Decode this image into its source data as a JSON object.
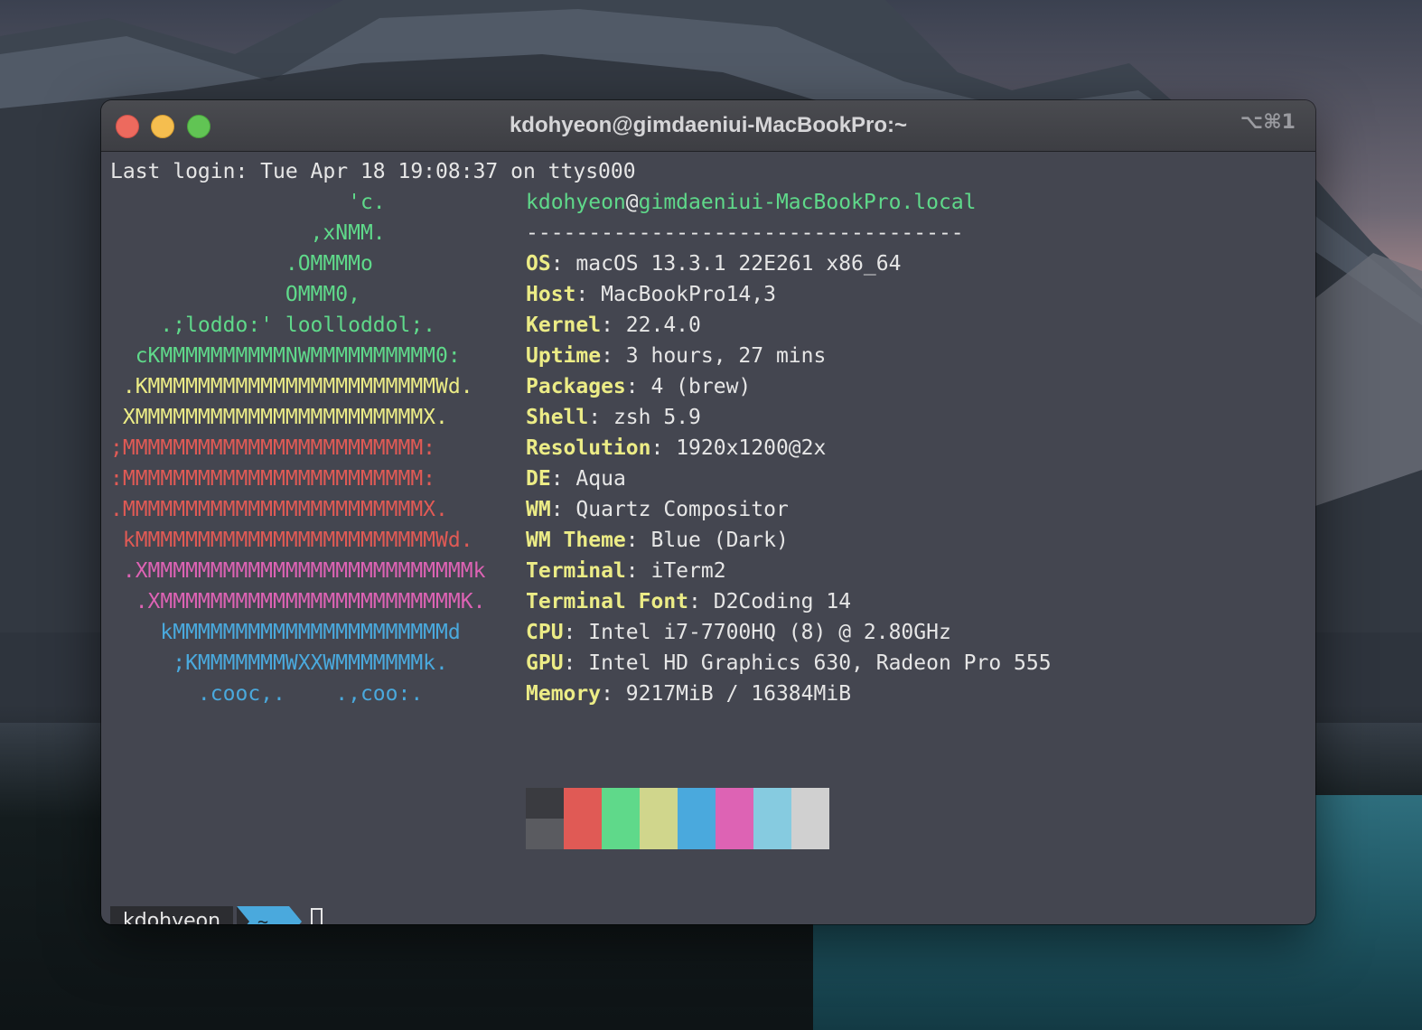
{
  "window": {
    "title": "kdohyeon@gimdaeniui-MacBookPro:~",
    "shortcut": "⌥⌘1"
  },
  "terminal": {
    "last_login": "Last login: Tue Apr 18 19:08:37 on ttys000",
    "ascii_art": [
      {
        "text": "                   'c.",
        "color": "#5fd98a"
      },
      {
        "text": "                ,xNMM.",
        "color": "#5fd98a"
      },
      {
        "text": "              .OMMMMo",
        "color": "#5fd98a"
      },
      {
        "text": "              OMMM0,",
        "color": "#5fd98a"
      },
      {
        "text": "    .;loddo:' loolloddol;.",
        "color": "#5fd98a"
      },
      {
        "text": "  cKMMMMMMMMMMNWMMMMMMMMMM0:",
        "color": "#5fd98a"
      },
      {
        "text": " .KMMMMMMMMMMMMMMMMMMMMMMMWd.",
        "color": "#ecec86"
      },
      {
        "text": " XMMMMMMMMMMMMMMMMMMMMMMMX.",
        "color": "#ecec86"
      },
      {
        "text": ";MMMMMMMMMMMMMMMMMMMMMMMM:",
        "color": "#e05a55"
      },
      {
        "text": ":MMMMMMMMMMMMMMMMMMMMMMMM:",
        "color": "#e05a55"
      },
      {
        "text": ".MMMMMMMMMMMMMMMMMMMMMMMMX.",
        "color": "#e05a55"
      },
      {
        "text": " kMMMMMMMMMMMMMMMMMMMMMMMMWd.",
        "color": "#e05a55"
      },
      {
        "text": " .XMMMMMMMMMMMMMMMMMMMMMMMMMMk",
        "color": "#dd63b4"
      },
      {
        "text": "  .XMMMMMMMMMMMMMMMMMMMMMMMMK.",
        "color": "#dd63b4"
      },
      {
        "text": "    kMMMMMMMMMMMMMMMMMMMMMMd",
        "color": "#4aa9dd"
      },
      {
        "text": "     ;KMMMMMMMWXXWMMMMMMMk.",
        "color": "#4aa9dd"
      },
      {
        "text": "       .cooc,.    .,coo:.",
        "color": "#4aa9dd"
      }
    ],
    "host_user": "kdohyeon",
    "host_at": "@",
    "host_name": "gimdaeniui-MacBookPro.local",
    "separator": "-----------------------------------",
    "info": [
      {
        "key": "OS",
        "value": "macOS 13.3.1 22E261 x86_64"
      },
      {
        "key": "Host",
        "value": "MacBookPro14,3"
      },
      {
        "key": "Kernel",
        "value": "22.4.0"
      },
      {
        "key": "Uptime",
        "value": "3 hours, 27 mins"
      },
      {
        "key": "Packages",
        "value": "4 (brew)"
      },
      {
        "key": "Shell",
        "value": "zsh 5.9"
      },
      {
        "key": "Resolution",
        "value": "1920x1200@2x"
      },
      {
        "key": "DE",
        "value": "Aqua"
      },
      {
        "key": "WM",
        "value": "Quartz Compositor"
      },
      {
        "key": "WM Theme",
        "value": "Blue (Dark)"
      },
      {
        "key": "Terminal",
        "value": "iTerm2"
      },
      {
        "key": "Terminal Font",
        "value": "D2Coding 14"
      },
      {
        "key": "CPU",
        "value": "Intel i7-7700HQ (8) @ 2.80GHz"
      },
      {
        "key": "GPU",
        "value": "Intel HD Graphics 630, Radeon Pro 555"
      },
      {
        "key": "Memory",
        "value": "9217MiB / 16384MiB"
      }
    ],
    "palette_top": [
      "#3a3b40",
      "#e05a55",
      "#5fd98a",
      "#d0d68c",
      "#4aa9dd",
      "#dd63b4",
      "#86cbe0",
      "#d0d0d0"
    ],
    "palette_bottom": [
      "#5a5b60",
      "#e05a55",
      "#5fd98a",
      "#d0d68c",
      "#4aa9dd",
      "#dd63b4",
      "#86cbe0",
      "#d0d0d0"
    ],
    "prompt_user": "kdohyeon",
    "prompt_dir": "~"
  }
}
